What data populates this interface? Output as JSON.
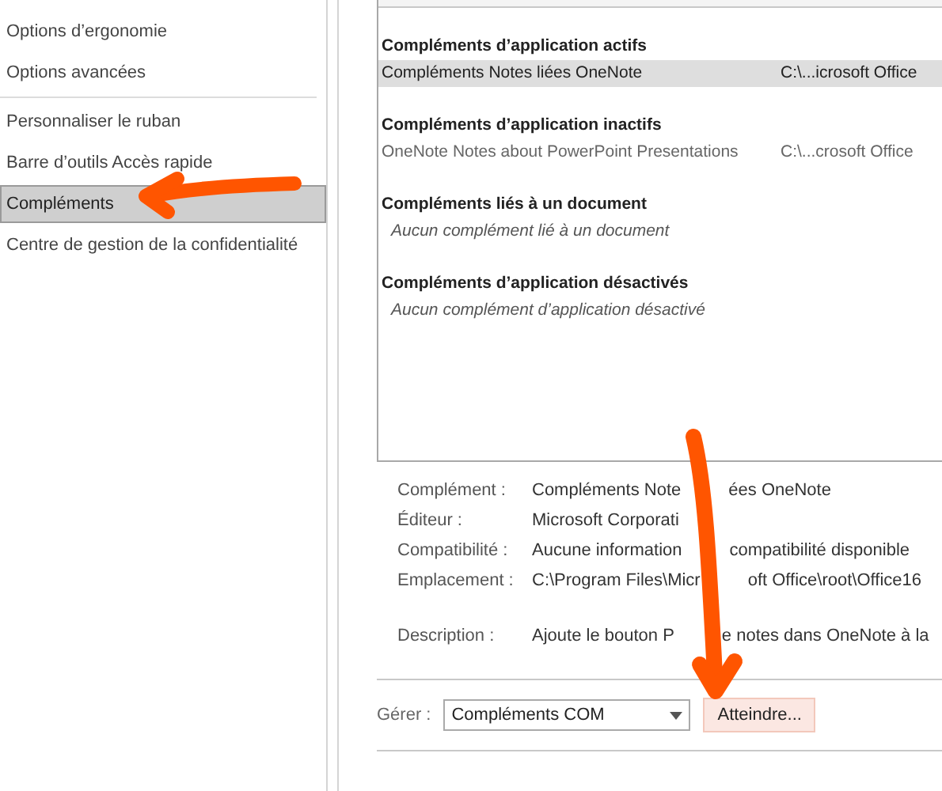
{
  "sidebar": {
    "items": [
      {
        "label": "Options d’ergonomie",
        "selected": false,
        "divider_above": false
      },
      {
        "label": "Options avancées",
        "selected": false,
        "divider_above": false
      },
      {
        "label": "Personnaliser le ruban",
        "selected": false,
        "divider_above": true
      },
      {
        "label": "Barre d’outils Accès rapide",
        "selected": false,
        "divider_above": false
      },
      {
        "label": "Compléments",
        "selected": true,
        "divider_above": false
      },
      {
        "label": "Centre de gestion de la confidentialité",
        "selected": false,
        "divider_above": false
      }
    ]
  },
  "addins_list": {
    "groups": [
      {
        "title": "Compléments d’application actifs",
        "items": [
          {
            "name": "Compléments Notes liées OneNote",
            "location": "C:\\...icrosoft Office",
            "selected": true,
            "kind": "addin"
          }
        ]
      },
      {
        "title": "Compléments d’application inactifs",
        "items": [
          {
            "name": "OneNote Notes about PowerPoint Presentations",
            "location": "C:\\...crosoft Office",
            "selected": false,
            "kind": "addin"
          }
        ]
      },
      {
        "title": "Compléments liés à un document",
        "items": [
          {
            "name": "Aucun complément lié à un document",
            "kind": "empty"
          }
        ]
      },
      {
        "title": "Compléments d’application désactivés",
        "items": [
          {
            "name": "Aucun complément d’application désactivé",
            "kind": "empty"
          }
        ]
      }
    ]
  },
  "details": [
    {
      "label": "Complément :",
      "parts": [
        "Compléments Note",
        "ées OneNote"
      ]
    },
    {
      "label": "Éditeur :",
      "parts": [
        "Microsoft Corporati"
      ]
    },
    {
      "label": "Compatibilité :",
      "parts": [
        "Aucune information",
        "compatibilité disponible"
      ]
    },
    {
      "label": "Emplacement :",
      "parts": [
        "C:\\Program Files\\Micr",
        "oft Office\\root\\Office16"
      ]
    },
    {
      "label": "Description :",
      "parts": [
        "Ajoute le bouton P",
        "e notes dans OneNote à la"
      ]
    }
  ],
  "manage": {
    "label": "Gérer :",
    "value": "Compléments COM",
    "button": "Atteindre..."
  }
}
